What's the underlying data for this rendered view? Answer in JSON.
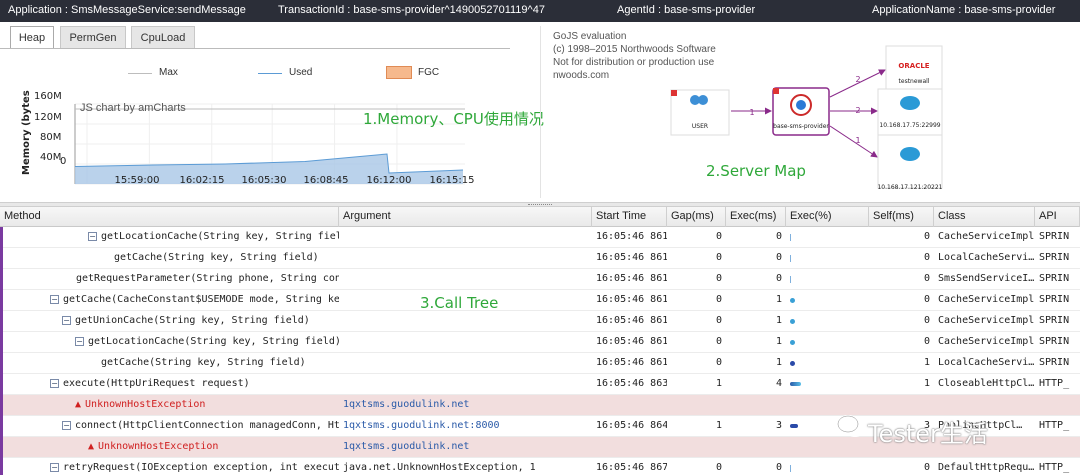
{
  "topbar": {
    "application": "Application : SmsMessageService:sendMessage",
    "transaction": "TransactionId : base-sms-provider^1490052701119^47",
    "agent": "AgentId : base-sms-provider",
    "appname": "ApplicationName : base-sms-provider"
  },
  "tabs": [
    "Heap",
    "PermGen",
    "CpuLoad"
  ],
  "legend": {
    "max": "Max",
    "used": "Used",
    "fgc": "FGC"
  },
  "chart_data": {
    "type": "area",
    "ylabel": "Memory (bytes",
    "watermark": "JS chart by amCharts",
    "y_ticks": [
      "160M",
      "120M",
      "80M",
      "40M",
      "0"
    ],
    "x_ticks": [
      "15:59:00",
      "16:02:15",
      "16:05:30",
      "16:08:45",
      "16:12:00",
      "16:15:15"
    ],
    "series": [
      {
        "name": "Max",
        "color": "#bdbdbd",
        "values": [
          150,
          150,
          150,
          150,
          150,
          150
        ]
      },
      {
        "name": "Used",
        "color": "#5b9bd5",
        "values": [
          35,
          38,
          40,
          45,
          60,
          22,
          28
        ]
      }
    ],
    "ylim": [
      0,
      160
    ]
  },
  "annotations": {
    "memory": "1.Memory、CPU使用情况",
    "server": "2.Server Map",
    "calltree": "3.Call Tree"
  },
  "gojs": {
    "line1": "GoJS evaluation",
    "line2": "(c) 1998–2015 Northwoods Software",
    "line3": "Not for distribution or production use",
    "line4": "nwoods.com"
  },
  "server_map": {
    "user": "USER",
    "provider": "base-sms-provider",
    "oracle_brand": "ORACLE",
    "oracle_label": "testnewall",
    "cloud1": "10.168.17.75:22999",
    "cloud2": "10.168.17.121:20221",
    "edge_user": "1",
    "edge_oracle": "2",
    "edge_cloud1": "2",
    "edge_cloud2": "1"
  },
  "grid": {
    "headers": [
      "Method",
      "Argument",
      "Start Time",
      "Gap(ms)",
      "Exec(ms)",
      "Exec(%)",
      "Self(ms)",
      "Class",
      "API"
    ],
    "rows": [
      {
        "indent": 88,
        "expand": true,
        "method": "getLocationCache(String key, String field)",
        "argument": "",
        "start": "16:05:46 861",
        "gap": "0",
        "exec": "0",
        "bar": 0.005,
        "self": "0",
        "class": "CacheServiceImpl",
        "api": "SPRIN"
      },
      {
        "indent": 114,
        "expand": false,
        "method": "getCache(String key, String field)",
        "argument": "",
        "start": "16:05:46 861",
        "gap": "0",
        "exec": "0",
        "bar": 0.005,
        "self": "0",
        "class": "LocalCacheServi…",
        "api": "SPRIN"
      },
      {
        "indent": 76,
        "expand": false,
        "method": "getRequestParameter(String phone, String conten",
        "argument": "",
        "start": "16:05:46 861",
        "gap": "0",
        "exec": "0",
        "bar": 0.005,
        "self": "0",
        "class": "SmsSendServiceI…",
        "api": "SPRIN"
      },
      {
        "indent": 50,
        "expand": true,
        "method": "getCache(CacheConstant$USEMODE mode, String key, S",
        "argument": "",
        "start": "16:05:46 861",
        "gap": "0",
        "exec": "1",
        "bar": 0.02,
        "self": "0",
        "class": "CacheServiceImpl",
        "api": "SPRIN"
      },
      {
        "indent": 62,
        "expand": true,
        "method": "getUnionCache(String key, String field)",
        "argument": "",
        "start": "16:05:46 861",
        "gap": "0",
        "exec": "1",
        "bar": 0.02,
        "self": "0",
        "class": "CacheServiceImpl",
        "api": "SPRIN"
      },
      {
        "indent": 75,
        "expand": true,
        "method": "getLocationCache(String key, String field)",
        "argument": "",
        "start": "16:05:46 861",
        "gap": "0",
        "exec": "1",
        "bar": 0.02,
        "self": "0",
        "class": "CacheServiceImpl",
        "api": "SPRIN"
      },
      {
        "indent": 101,
        "expand": false,
        "method": "getCache(String key, String field)",
        "argument": "",
        "start": "16:05:46 861",
        "gap": "0",
        "exec": "1",
        "bar": 0.02,
        "self": "1",
        "class": "LocalCacheServi…",
        "api": "SPRIN"
      },
      {
        "indent": 50,
        "expand": true,
        "method": "execute(HttpUriRequest request)",
        "argument": "",
        "start": "16:05:46 863",
        "gap": "1",
        "exec": "4",
        "bar": 0.16,
        "self": "1",
        "class": "CloseableHttpCl…",
        "api": "HTTP_"
      },
      {
        "indent": 75,
        "expand": false,
        "error": true,
        "method": "UnknownHostException",
        "argument": "1qxtsms.guodulink.net",
        "start": "",
        "gap": "",
        "exec": "",
        "bar": 0,
        "self": "",
        "class": "",
        "api": ""
      },
      {
        "indent": 62,
        "expand": true,
        "method": "connect(HttpClientConnection managedConn, HttpRo",
        "argument": "1qxtsms.guodulink.net:8000",
        "start": "16:05:46 864",
        "gap": "1",
        "exec": "3",
        "bar": 0.12,
        "self": "3",
        "class": "PoolingHttpCl…",
        "api": "HTTP_"
      },
      {
        "indent": 88,
        "expand": false,
        "error": true,
        "method": "UnknownHostException",
        "argument": "1qxtsms.guodulink.net",
        "start": "",
        "gap": "",
        "exec": "",
        "bar": 0,
        "self": "",
        "class": "",
        "api": ""
      },
      {
        "indent": 50,
        "expand": true,
        "method": "retryRequest(IOException exception, int executi",
        "argument": "java.net.UnknownHostException, 1",
        "start": "16:05:46 867",
        "gap": "0",
        "exec": "0",
        "bar": 0.005,
        "self": "0",
        "class": "DefaultHttpRequ…",
        "api": "HTTP_"
      }
    ]
  },
  "watermark_text": "Tester生活",
  "colors": {
    "topbar": "#2b2e38",
    "annotation": "#2fa83a",
    "error_row": "#f2dede",
    "bar": "#2a5aa8",
    "used_fill": "#a9c7e6"
  }
}
